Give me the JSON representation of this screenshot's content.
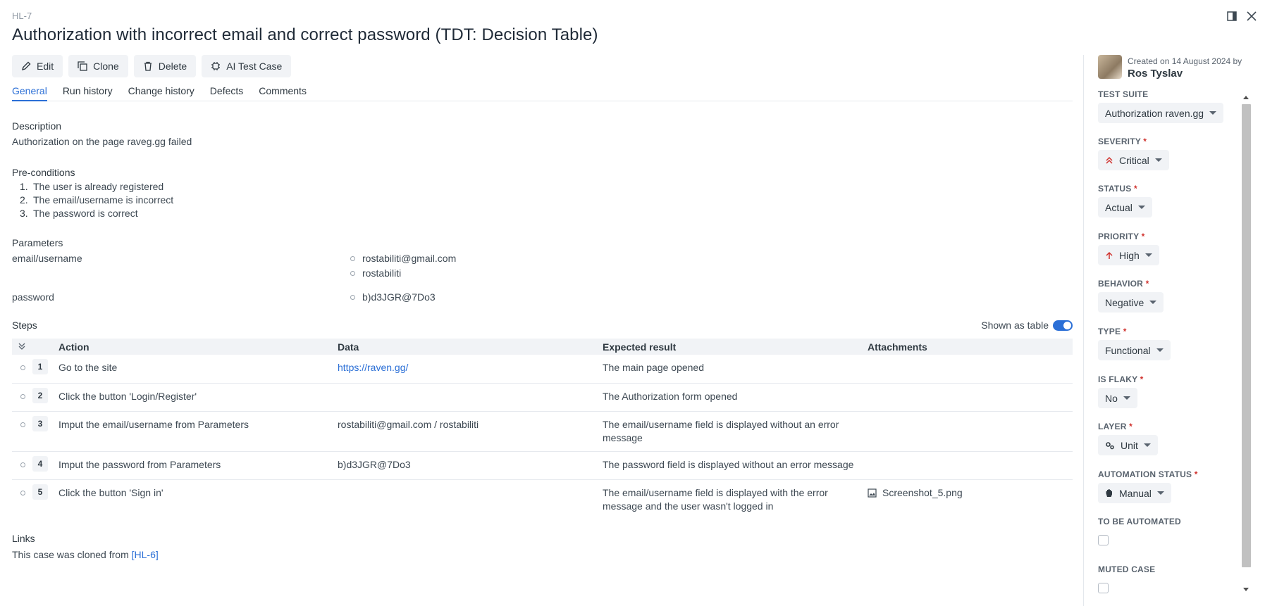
{
  "header": {
    "case_id": "HL-7",
    "title": "Authorization with incorrect email and correct password (TDT: Decision Table)"
  },
  "toolbar": {
    "edit": "Edit",
    "clone": "Clone",
    "delete": "Delete",
    "ai": "AI Test Case"
  },
  "tabs": [
    "General",
    "Run history",
    "Change history",
    "Defects",
    "Comments"
  ],
  "description": {
    "heading": "Description",
    "text": "Authorization on the page raveg.gg failed"
  },
  "preconditions": {
    "heading": "Pre-conditions",
    "items": [
      "The user is already registered",
      "The email/username is incorrect",
      "The password is correct"
    ]
  },
  "parameters": {
    "heading": "Parameters",
    "items": [
      {
        "name": "email/username",
        "values": [
          "rostabiliti@gmail.com",
          "rostabiliti"
        ]
      },
      {
        "name": "password",
        "values": [
          "b)d3JGR@7Do3"
        ]
      }
    ]
  },
  "steps": {
    "heading": "Steps",
    "toggle_label": "Shown as table",
    "columns": [
      "Action",
      "Data",
      "Expected result",
      "Attachments"
    ],
    "rows": [
      {
        "n": "1",
        "action": "Go to the site",
        "data": "https://raven.gg/",
        "result": "The main page opened",
        "attachment": ""
      },
      {
        "n": "2",
        "action": "Click the button 'Login/Register'",
        "data": "",
        "result": "The Authorization form opened",
        "attachment": ""
      },
      {
        "n": "3",
        "action": "Imput the email/username from Parameters",
        "data": "rostabiliti@gmail.com / rostabiliti",
        "result": "The email/username field is displayed without an error message",
        "attachment": ""
      },
      {
        "n": "4",
        "action": "Imput the password from Parameters",
        "data": "b)d3JGR@7Do3",
        "result": "The password field is displayed without an error message",
        "attachment": ""
      },
      {
        "n": "5",
        "action": "Click the button 'Sign in'",
        "data": "",
        "result": "The email/username field is displayed with the error message and the user wasn't logged in",
        "attachment": "Screenshot_5.png"
      }
    ]
  },
  "links": {
    "heading": "Links",
    "text": "This case was cloned from ",
    "link": "[HL-6]"
  },
  "sidebar": {
    "created": "Created on 14 August 2024 by",
    "author": "Ros Tyslav",
    "required_mark": "*",
    "fields": {
      "test_suite": {
        "label": "TEST SUITE",
        "value": "Authorization raven.gg"
      },
      "severity": {
        "label": "SEVERITY",
        "value": "Critical"
      },
      "status": {
        "label": "STATUS",
        "value": "Actual"
      },
      "priority": {
        "label": "PRIORITY",
        "value": "High"
      },
      "behavior": {
        "label": "BEHAVIOR",
        "value": "Negative"
      },
      "type": {
        "label": "TYPE",
        "value": "Functional"
      },
      "is_flaky": {
        "label": "IS FLAKY",
        "value": "No"
      },
      "layer": {
        "label": "LAYER",
        "value": "Unit"
      },
      "automation_status": {
        "label": "AUTOMATION STATUS",
        "value": "Manual"
      },
      "to_be_automated": {
        "label": "TO BE AUTOMATED"
      },
      "muted_case": {
        "label": "MUTED CASE"
      }
    }
  },
  "colors": {
    "accent": "#2b6fd6",
    "critical": "#d0312d",
    "required": "#d0312d"
  }
}
